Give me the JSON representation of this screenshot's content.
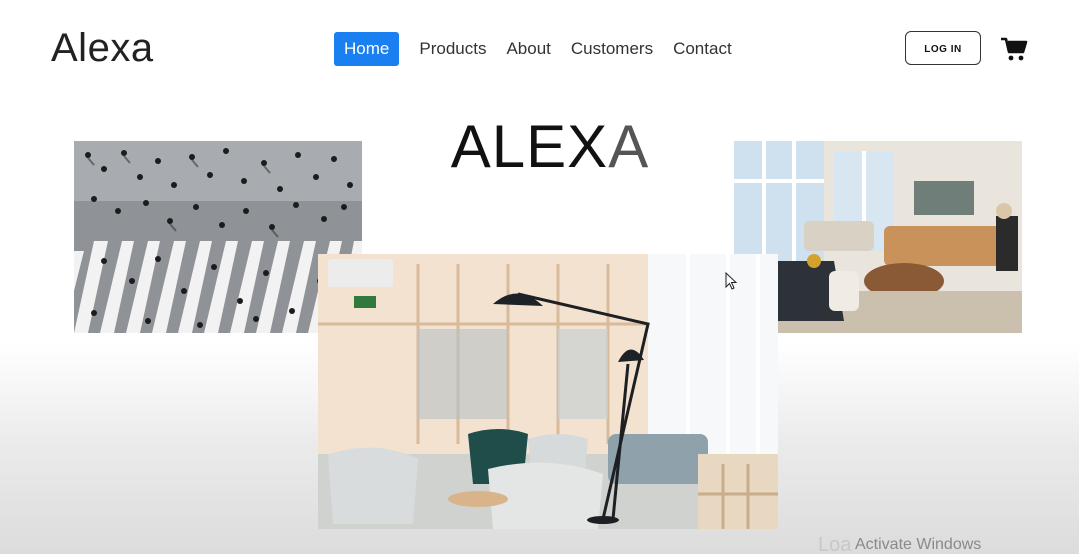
{
  "brand": {
    "name": "Alexa"
  },
  "nav": {
    "items": [
      {
        "label": "Home",
        "active": true
      },
      {
        "label": "Products",
        "active": false
      },
      {
        "label": "About",
        "active": false
      },
      {
        "label": "Customers",
        "active": false
      },
      {
        "label": "Contact",
        "active": false
      }
    ],
    "active_color": "#1a7ff0"
  },
  "header": {
    "login_label": "LOG IN",
    "cart_icon": "cart-icon"
  },
  "hero": {
    "title_main": "ALEX",
    "title_last": "A"
  },
  "gallery": {
    "images": [
      {
        "name": "crowd-crosswalk-photo"
      },
      {
        "name": "living-room-photo"
      },
      {
        "name": "office-lounge-photo"
      }
    ]
  },
  "overlay": {
    "partial_text": "Loa",
    "watermark": "Activate Windows"
  }
}
